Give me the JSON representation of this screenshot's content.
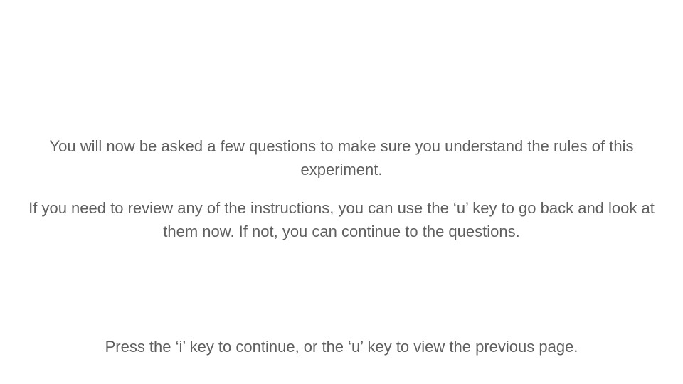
{
  "instructions": {
    "paragraph_1": "You will now be asked a few questions to make sure you understand the rules of this experiment.",
    "paragraph_2": "If you need to review any of the instructions, you can use the ‘u’ key to go back and look at them now. If not, you can continue to the questions."
  },
  "footer": {
    "prompt": "Press the ‘i’ key to continue, or the ‘u’ key to view the previous page."
  },
  "colors": {
    "background": "#ffffff",
    "text": "#5f5f5f"
  }
}
